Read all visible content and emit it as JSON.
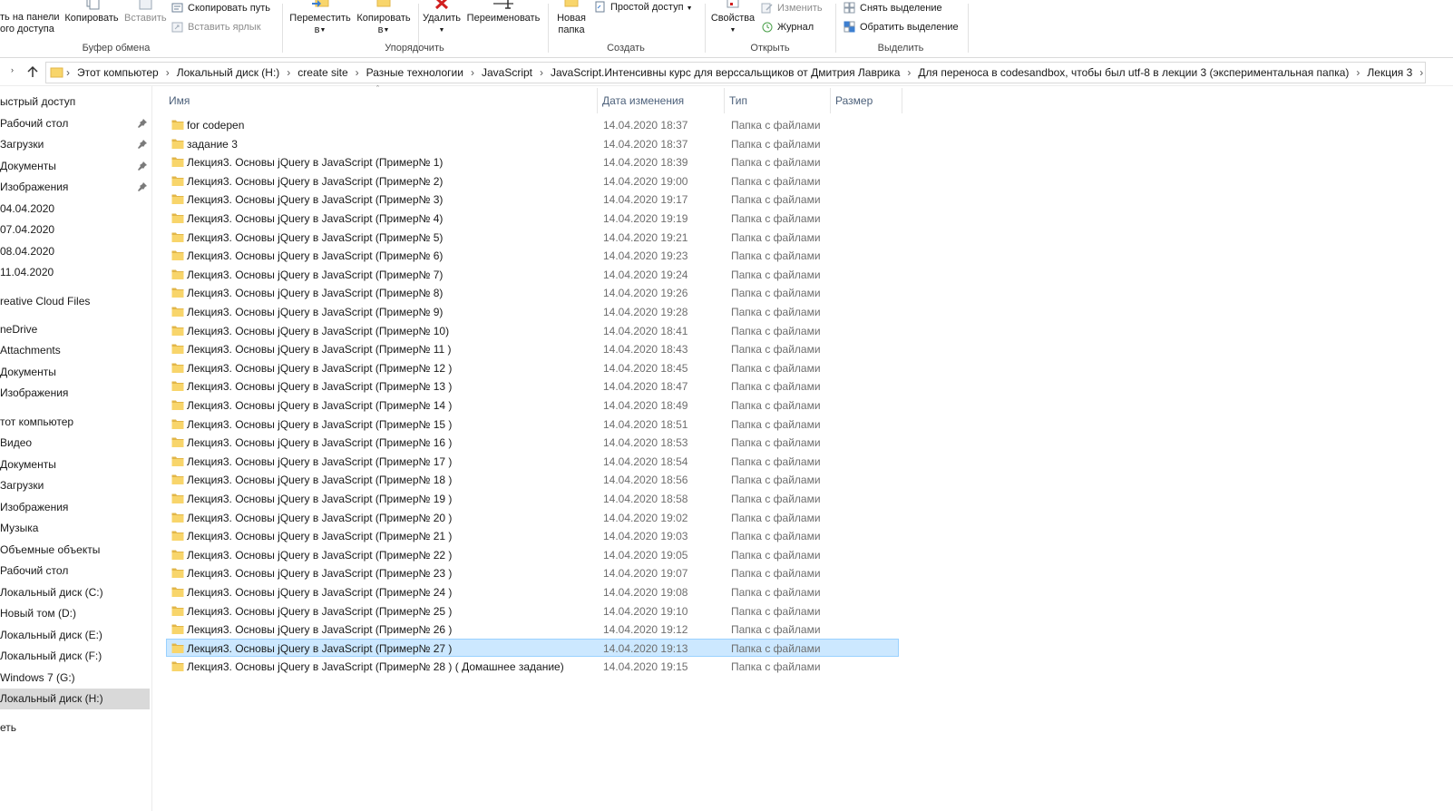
{
  "ribbon": {
    "clipboard": {
      "pin_label_line1": "ть на панели",
      "pin_label_line2": "ого доступа",
      "copy_label": "Копировать",
      "paste_label": "Вставить",
      "copy_path_label": "Скопировать путь",
      "paste_shortcut_label": "Вставить ярлык",
      "group_label": "Буфер обмена"
    },
    "organize": {
      "move_label_line1": "Переместить",
      "move_label_line2": "в",
      "copy_to_label_line1": "Копировать",
      "copy_to_label_line2": "в",
      "delete_label": "Удалить",
      "rename_label": "Переименовать",
      "group_label": "Упорядочить"
    },
    "create": {
      "new_folder_line1": "Новая",
      "new_folder_line2": "папка",
      "easy_access_label": "Простой доступ",
      "group_label": "Создать"
    },
    "open": {
      "properties_label": "Свойства",
      "edit_label": "Изменить",
      "history_label": "Журнал",
      "group_label": "Открыть"
    },
    "select": {
      "select_none_label": "Снять выделение",
      "invert_label": "Обратить выделение",
      "group_label": "Выделить"
    }
  },
  "address": {
    "crumbs": [
      "Этот компьютер",
      "Локальный диск (H:)",
      "create site",
      "Разные технологии",
      "JavaScript",
      "JavaScript.Интенсивны курс для верссальщиков от Дмитрия Лаврика",
      "Для переноса в codesandbox, чтобы был  utf-8 в лекции 3 (экспериментальная папка)",
      "Лекция 3"
    ]
  },
  "nav": {
    "items": [
      {
        "label": "ыстрый доступ",
        "pinned": false
      },
      {
        "label": "Рабочий стол",
        "pinned": true
      },
      {
        "label": "Загрузки",
        "pinned": true
      },
      {
        "label": "Документы",
        "pinned": true
      },
      {
        "label": "Изображения",
        "pinned": true
      },
      {
        "label": "04.04.2020",
        "pinned": false
      },
      {
        "label": "07.04.2020",
        "pinned": false
      },
      {
        "label": "08.04.2020",
        "pinned": false
      },
      {
        "label": "11.04.2020",
        "pinned": false
      },
      {
        "label": "reative Cloud Files",
        "pinned": false
      },
      {
        "label": "neDrive",
        "pinned": false
      },
      {
        "label": "Attachments",
        "pinned": false
      },
      {
        "label": "Документы",
        "pinned": false
      },
      {
        "label": "Изображения",
        "pinned": false
      },
      {
        "label": "тот компьютер",
        "pinned": false
      },
      {
        "label": "Видео",
        "pinned": false
      },
      {
        "label": "Документы",
        "pinned": false
      },
      {
        "label": "Загрузки",
        "pinned": false
      },
      {
        "label": "Изображения",
        "pinned": false
      },
      {
        "label": "Музыка",
        "pinned": false
      },
      {
        "label": "Объемные объекты",
        "pinned": false
      },
      {
        "label": "Рабочий стол",
        "pinned": false
      },
      {
        "label": "Локальный диск (C:)",
        "pinned": false
      },
      {
        "label": "Новый том (D:)",
        "pinned": false
      },
      {
        "label": "Локальный диск (E:)",
        "pinned": false
      },
      {
        "label": "Локальный диск (F:)",
        "pinned": false
      },
      {
        "label": "Windows 7 (G:)",
        "pinned": false
      },
      {
        "label": "Локальный диск (H:)",
        "pinned": false,
        "selected": true
      },
      {
        "label": "еть",
        "pinned": false
      }
    ]
  },
  "columns": {
    "name": "Имя",
    "date": "Дата изменения",
    "type": "Тип",
    "size": "Размер"
  },
  "files": [
    {
      "name": "for codepen",
      "date": "14.04.2020 18:37",
      "type": "Папка с файлами"
    },
    {
      "name": "задание 3",
      "date": "14.04.2020 18:37",
      "type": "Папка с файлами"
    },
    {
      "name": "Лекция3. Основы jQuery в JavaScript (Пример№ 1)",
      "date": "14.04.2020 18:39",
      "type": "Папка с файлами"
    },
    {
      "name": "Лекция3. Основы jQuery в JavaScript (Пример№ 2)",
      "date": "14.04.2020 19:00",
      "type": "Папка с файлами"
    },
    {
      "name": "Лекция3. Основы jQuery в JavaScript (Пример№ 3)",
      "date": "14.04.2020 19:17",
      "type": "Папка с файлами"
    },
    {
      "name": "Лекция3. Основы jQuery в JavaScript (Пример№ 4)",
      "date": "14.04.2020 19:19",
      "type": "Папка с файлами"
    },
    {
      "name": "Лекция3. Основы jQuery в JavaScript (Пример№ 5)",
      "date": "14.04.2020 19:21",
      "type": "Папка с файлами"
    },
    {
      "name": "Лекция3. Основы jQuery в JavaScript (Пример№ 6)",
      "date": "14.04.2020 19:23",
      "type": "Папка с файлами"
    },
    {
      "name": "Лекция3. Основы jQuery в JavaScript (Пример№ 7)",
      "date": "14.04.2020 19:24",
      "type": "Папка с файлами"
    },
    {
      "name": "Лекция3. Основы jQuery в JavaScript (Пример№ 8)",
      "date": "14.04.2020 19:26",
      "type": "Папка с файлами"
    },
    {
      "name": "Лекция3. Основы jQuery в JavaScript (Пример№ 9)",
      "date": "14.04.2020 19:28",
      "type": "Папка с файлами"
    },
    {
      "name": "Лекция3. Основы jQuery в JavaScript (Пример№ 10)",
      "date": "14.04.2020 18:41",
      "type": "Папка с файлами"
    },
    {
      "name": "Лекция3. Основы jQuery в JavaScript (Пример№ 11 )",
      "date": "14.04.2020 18:43",
      "type": "Папка с файлами"
    },
    {
      "name": "Лекция3. Основы jQuery в JavaScript (Пример№ 12 )",
      "date": "14.04.2020 18:45",
      "type": "Папка с файлами"
    },
    {
      "name": "Лекция3. Основы jQuery в JavaScript (Пример№ 13 )",
      "date": "14.04.2020 18:47",
      "type": "Папка с файлами"
    },
    {
      "name": "Лекция3. Основы jQuery в JavaScript (Пример№ 14 )",
      "date": "14.04.2020 18:49",
      "type": "Папка с файлами"
    },
    {
      "name": "Лекция3. Основы jQuery в JavaScript (Пример№ 15 )",
      "date": "14.04.2020 18:51",
      "type": "Папка с файлами"
    },
    {
      "name": "Лекция3. Основы jQuery в JavaScript (Пример№ 16 )",
      "date": "14.04.2020 18:53",
      "type": "Папка с файлами"
    },
    {
      "name": "Лекция3. Основы jQuery в JavaScript (Пример№ 17 )",
      "date": "14.04.2020 18:54",
      "type": "Папка с файлами"
    },
    {
      "name": "Лекция3. Основы jQuery в JavaScript (Пример№ 18 )",
      "date": "14.04.2020 18:56",
      "type": "Папка с файлами"
    },
    {
      "name": "Лекция3. Основы jQuery в JavaScript (Пример№ 19 )",
      "date": "14.04.2020 18:58",
      "type": "Папка с файлами"
    },
    {
      "name": "Лекция3. Основы jQuery в JavaScript (Пример№ 20 )",
      "date": "14.04.2020 19:02",
      "type": "Папка с файлами"
    },
    {
      "name": "Лекция3. Основы jQuery в JavaScript (Пример№ 21 )",
      "date": "14.04.2020 19:03",
      "type": "Папка с файлами"
    },
    {
      "name": "Лекция3. Основы jQuery в JavaScript (Пример№ 22 )",
      "date": "14.04.2020 19:05",
      "type": "Папка с файлами"
    },
    {
      "name": "Лекция3. Основы jQuery в JavaScript (Пример№ 23 )",
      "date": "14.04.2020 19:07",
      "type": "Папка с файлами"
    },
    {
      "name": "Лекция3. Основы jQuery в JavaScript (Пример№ 24 )",
      "date": "14.04.2020 19:08",
      "type": "Папка с файлами"
    },
    {
      "name": "Лекция3. Основы jQuery в JavaScript (Пример№ 25 )",
      "date": "14.04.2020 19:10",
      "type": "Папка с файлами"
    },
    {
      "name": "Лекция3. Основы jQuery в JavaScript (Пример№ 26 )",
      "date": "14.04.2020 19:12",
      "type": "Папка с файлами"
    },
    {
      "name": "Лекция3. Основы jQuery в JavaScript (Пример№ 27 )",
      "date": "14.04.2020 19:13",
      "type": "Папка с файлами",
      "selected": true
    },
    {
      "name": "Лекция3. Основы jQuery в JavaScript (Пример№ 28 ) ( Домашнее задание)",
      "date": "14.04.2020 19:15",
      "type": "Папка с файлами"
    }
  ],
  "colors": {
    "folder": "#f8d56b",
    "folder_dark": "#e2b648",
    "selection_bg": "#cce8ff",
    "selection_border": "#99d1ff",
    "nav_selected_bg": "#d9d9d9",
    "delete_red": "#d11f1f"
  }
}
